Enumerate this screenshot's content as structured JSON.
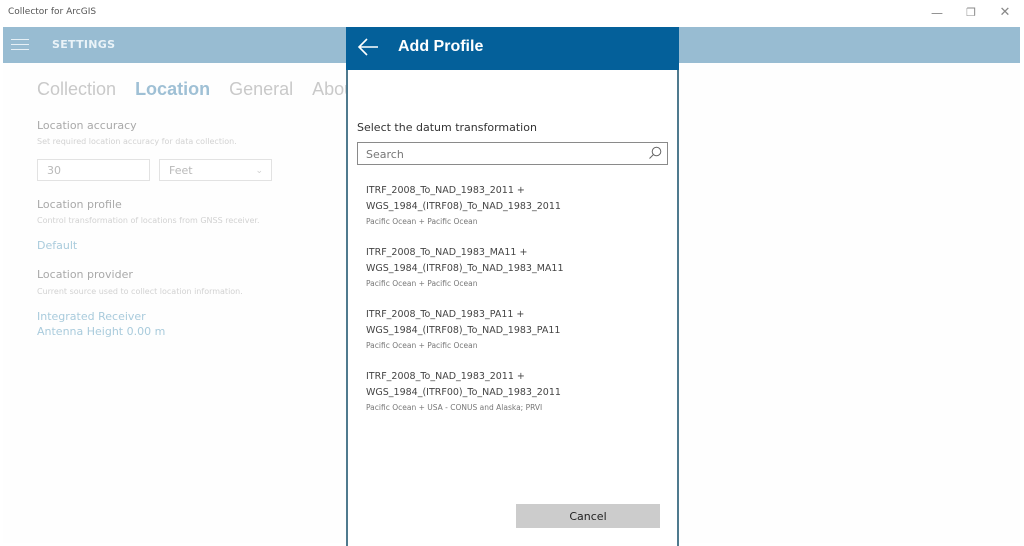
{
  "window": {
    "title": "Collector for ArcGIS",
    "controls": {
      "minimize": "—",
      "maximize": "❐",
      "close": "✕"
    }
  },
  "appbar": {
    "menu_icon": "hamburger-icon",
    "title": "SETTINGS"
  },
  "settings": {
    "tabs": [
      {
        "label": "Collection",
        "active": false
      },
      {
        "label": "Location",
        "active": true
      },
      {
        "label": "General",
        "active": false
      },
      {
        "label": "About",
        "active": false
      }
    ],
    "location_accuracy": {
      "title": "Location accuracy",
      "description": "Set required location accuracy for data collection.",
      "value": "30",
      "unit": "Feet"
    },
    "location_profile": {
      "title": "Location profile",
      "description": "Control transformation of locations from GNSS receiver.",
      "value": "Default"
    },
    "location_provider": {
      "title": "Location provider",
      "description": "Current source used to collect location information.",
      "receiver": "Integrated Receiver",
      "antenna_height": "Antenna Height 0.00 m"
    }
  },
  "modal": {
    "title": "Add Profile",
    "back_icon": "back-arrow-icon",
    "prompt": "Select the datum transformation",
    "search": {
      "placeholder": "Search",
      "value": ""
    },
    "items": [
      {
        "line1": "ITRF_2008_To_NAD_1983_2011 +",
        "line2": "WGS_1984_(ITRF08)_To_NAD_1983_2011",
        "area": "Pacific Ocean + Pacific Ocean"
      },
      {
        "line1": "ITRF_2008_To_NAD_1983_MA11 +",
        "line2": "WGS_1984_(ITRF08)_To_NAD_1983_MA11",
        "area": "Pacific Ocean + Pacific Ocean"
      },
      {
        "line1": "ITRF_2008_To_NAD_1983_PA11 +",
        "line2": "WGS_1984_(ITRF08)_To_NAD_1983_PA11",
        "area": "Pacific Ocean + Pacific Ocean"
      },
      {
        "line1": "ITRF_2008_To_NAD_1983_2011 +",
        "line2": "WGS_1984_(ITRF00)_To_NAD_1983_2011",
        "area": "Pacific Ocean + USA - CONUS and Alaska; PRVI"
      }
    ],
    "cancel_label": "Cancel"
  }
}
